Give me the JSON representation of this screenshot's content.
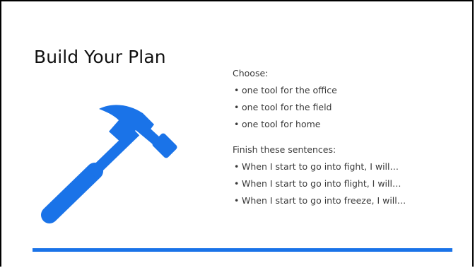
{
  "slide": {
    "title": "Build Your Plan",
    "icon": "hammer-icon",
    "accent_color": "#1a73e8",
    "choose": {
      "heading": "Choose:",
      "items": [
        "one tool for the office",
        "one tool for the field",
        "one tool for home"
      ]
    },
    "finish": {
      "heading": "Finish these sentences:",
      "items": [
        "When I start to go into fight, I will…",
        "When I start to go into flight, I will…",
        "When I start to go into freeze, I will…"
      ]
    }
  }
}
